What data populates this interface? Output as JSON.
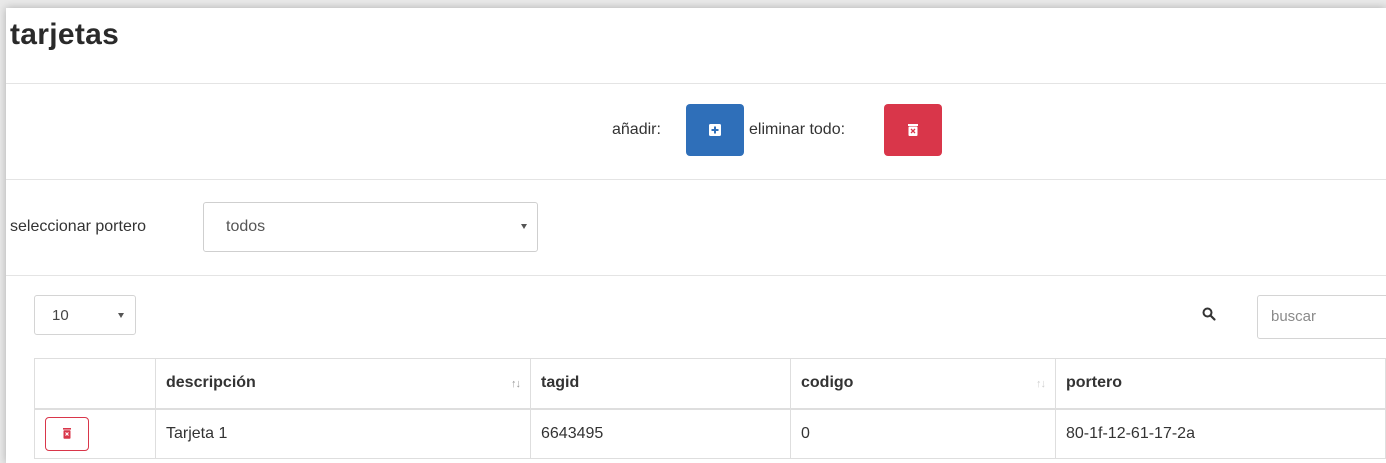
{
  "page": {
    "title": "tarjetas"
  },
  "actions": {
    "add_label": "añadir:",
    "delete_all_label": "eliminar todo:",
    "add_icon": "plus-square-icon",
    "delete_icon": "trash-icon",
    "add_color": "#2f6fb9",
    "delete_color": "#d9364a"
  },
  "filter": {
    "label": "seleccionar portero",
    "selected": "todos"
  },
  "table_controls": {
    "page_length": "10",
    "search_placeholder": "buscar",
    "search_icon": "magnifier-icon"
  },
  "table": {
    "columns": [
      {
        "label": "",
        "sort": "none"
      },
      {
        "label": "descripción",
        "sort": "asc"
      },
      {
        "label": "tagid",
        "sort": "none"
      },
      {
        "label": "codigo",
        "sort": "both"
      },
      {
        "label": "portero",
        "sort": "none"
      }
    ],
    "rows": [
      {
        "descripcion": "Tarjeta 1",
        "tagid": "6643495",
        "codigo": "0",
        "portero": "80-1f-12-61-17-2a"
      }
    ]
  }
}
